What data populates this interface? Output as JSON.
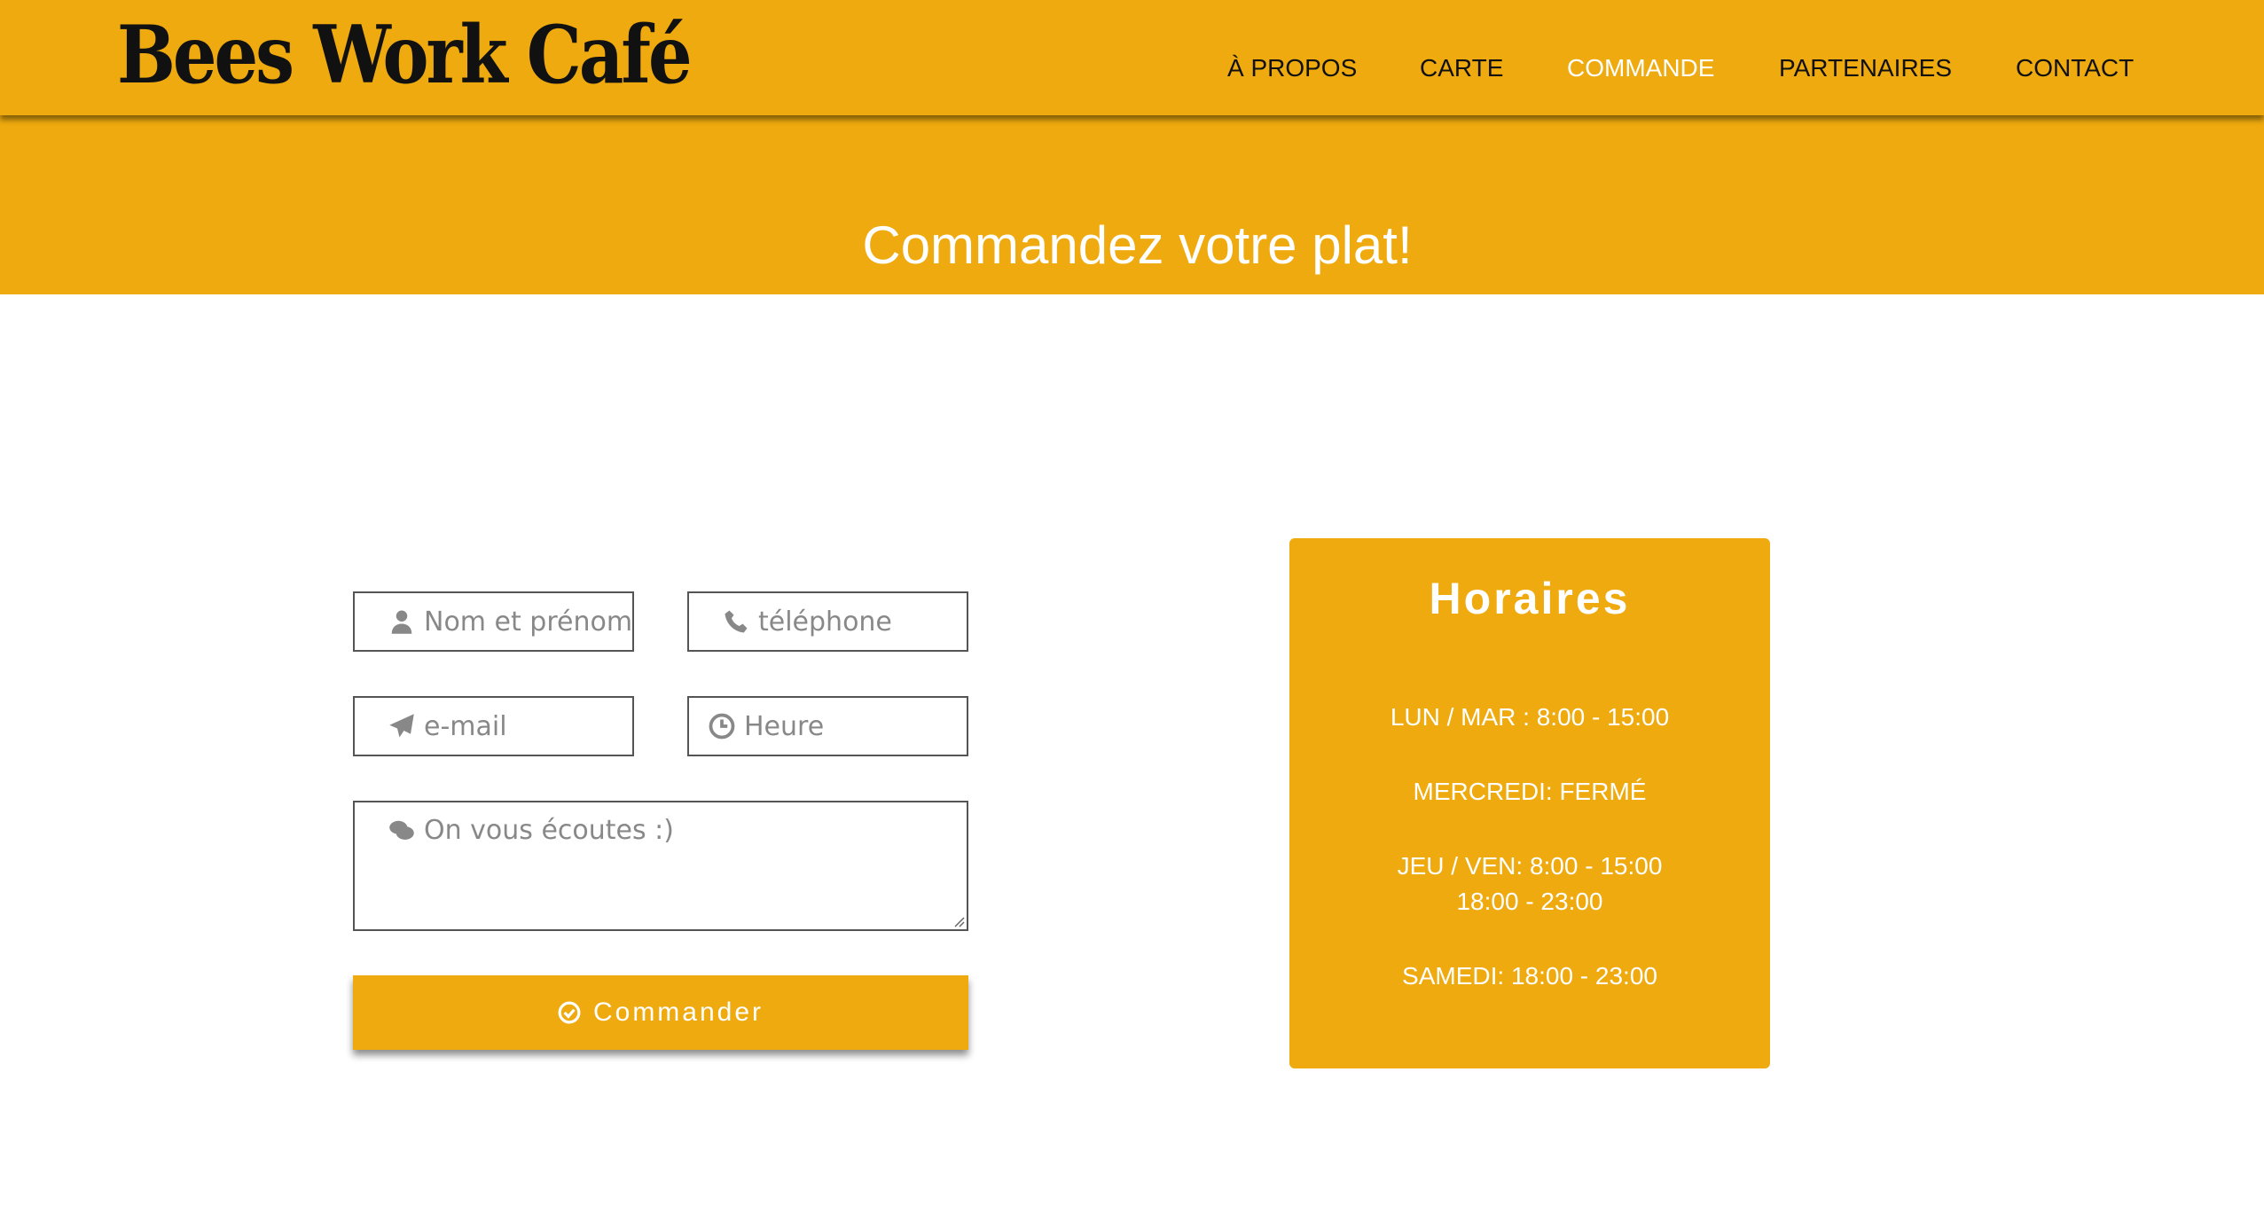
{
  "brand": {
    "logo_text": "Bees Work Café",
    "primary_color": "#eeaa0e",
    "text_dark": "#111111",
    "text_light": "#ffffff"
  },
  "nav": {
    "items": [
      {
        "label": "À PROPOS",
        "active": false
      },
      {
        "label": "CARTE",
        "active": false
      },
      {
        "label": "COMMANDE",
        "active": true
      },
      {
        "label": "PARTENAIRES",
        "active": false
      },
      {
        "label": "CONTACT",
        "active": false
      }
    ]
  },
  "hero": {
    "title": "Commandez votre plat!"
  },
  "form": {
    "name": {
      "placeholder": "Nom et prénom",
      "value": "",
      "icon": "user-icon"
    },
    "phone": {
      "placeholder": "téléphone",
      "value": "",
      "icon": "phone-icon"
    },
    "email": {
      "placeholder": "e-mail",
      "value": "",
      "icon": "paper-plane-icon"
    },
    "time": {
      "placeholder": "Heure",
      "value": "",
      "icon": "clock-icon"
    },
    "message": {
      "placeholder": "On vous écoutes :)",
      "value": "",
      "icon": "comments-icon"
    },
    "submit": {
      "label": "Commander",
      "icon": "check-circle-icon"
    }
  },
  "hours": {
    "title": "Horaires",
    "lines": [
      "LUN / MAR : 8:00 - 15:00",
      "MERCREDI: FERMÉ",
      "JEU / VEN: 8:00 - 15:00",
      "18:00 - 23:00",
      "SAMEDI: 18:00 - 23:00"
    ]
  }
}
